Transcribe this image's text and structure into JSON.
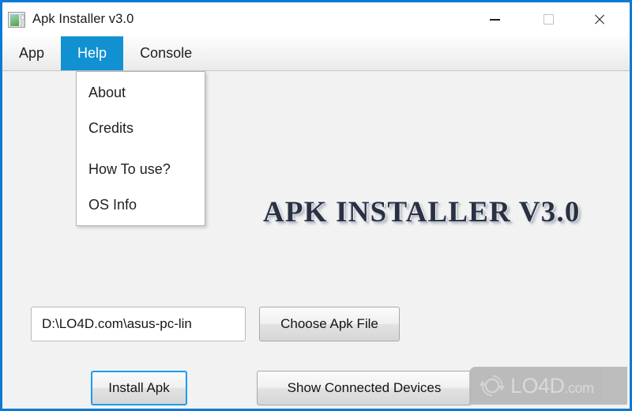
{
  "window": {
    "title": "Apk Installer v3.0",
    "icon": "app-window-icon",
    "accent_border": "#0a7bd4",
    "controls": {
      "minimize": "minimize-icon",
      "maximize": "maximize-icon",
      "close": "close-icon"
    }
  },
  "menubar": {
    "items": [
      {
        "label": "App",
        "active": false
      },
      {
        "label": "Help",
        "active": true
      },
      {
        "label": "Console",
        "active": false
      }
    ],
    "highlight_color": "#1191d1"
  },
  "dropdown": {
    "owner": "Help",
    "groups": [
      {
        "items": [
          {
            "label": "About"
          },
          {
            "label": "Credits"
          }
        ]
      },
      {
        "items": [
          {
            "label": "How To use?"
          },
          {
            "label": "OS Info"
          }
        ]
      }
    ]
  },
  "main": {
    "logo_text": "APK INSTALLER V3.0",
    "logo_color": "#2a3142",
    "path_field": {
      "value": "D:\\LO4D.com\\asus-pc-lin",
      "placeholder": ""
    },
    "buttons": {
      "choose": "Choose Apk File",
      "install": "Install Apk",
      "devices": "Show Connected Devices"
    },
    "focus_color": "#1d9bf0"
  },
  "watermark": {
    "name": "LO4D",
    "tld": ".com",
    "icon": "refresh-circle-icon"
  }
}
